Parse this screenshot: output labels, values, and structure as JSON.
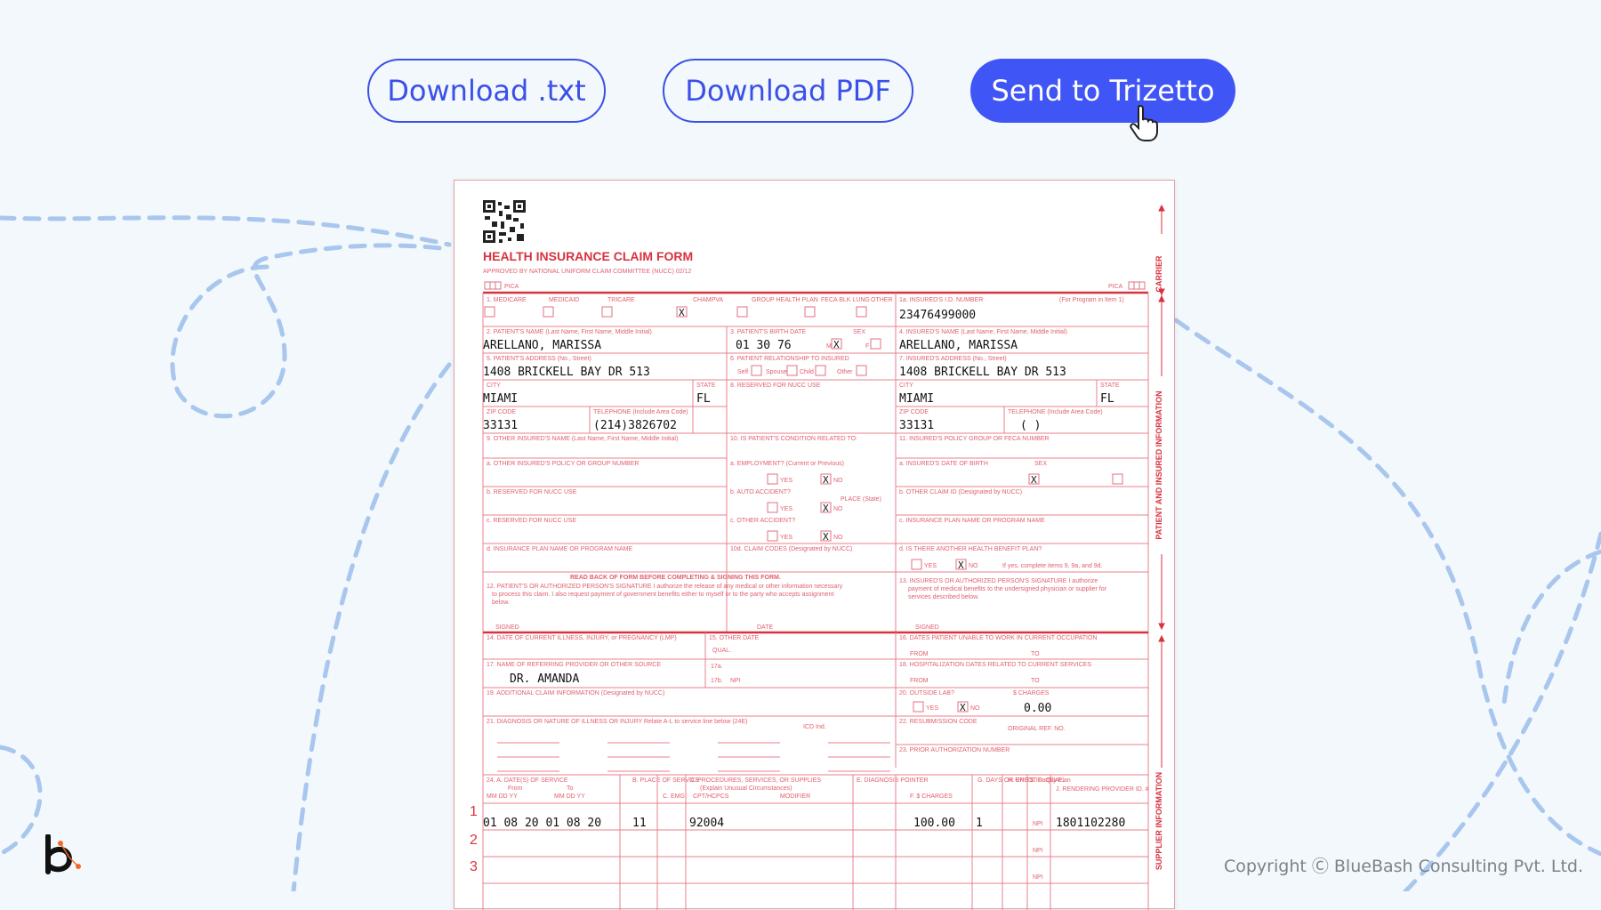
{
  "buttons": {
    "download_txt": "Download .txt",
    "download_pdf": "Download PDF",
    "send_trizetto": "Send to Trizetto"
  },
  "form": {
    "title": "HEALTH INSURANCE CLAIM FORM",
    "approved": "APPROVED BY NATIONAL UNIFORM CLAIM COMMITTEE (NUCC) 02/12",
    "pica": "PICA",
    "side_carrier": "CARRIER",
    "side_patient": "PATIENT AND INSURED INFORMATION",
    "side_supplier": "SUPPLIER INFORMATION",
    "insured_id": "23476499000",
    "patient_name": "ARELLANO, MARISSA",
    "birth_date": "01 30 76",
    "insured_name": "ARELLANO, MARISSA",
    "patient_address": "1408 BRICKELL BAY DR 513",
    "insured_address": "1408 BRICKELL BAY DR 513",
    "patient_city": "MIAMI",
    "patient_state": "FL",
    "insured_city": "MIAMI",
    "insured_state": "FL",
    "patient_zip": "33131",
    "patient_phone": "(214)3826702",
    "insured_zip": "33131",
    "insured_phone": "(   )",
    "referring_provider": "DR. AMANDA",
    "outside_lab_charges": "0.00",
    "service_line_num_1": "1",
    "service_line_num_2": "2",
    "service_line_num_3": "3",
    "service_line_1": {
      "dates": "01 08 20 01 08 20",
      "place": "11",
      "cpt": "92004",
      "charges": "100.00",
      "units": "1",
      "npi_label": "NPI",
      "provider_id": "1801102280"
    },
    "x_mark": "X",
    "labels": {
      "l1": "1. MEDICARE",
      "l1_medicaid": "MEDICAID",
      "l1_tricare": "TRICARE",
      "l1_champva": "CHAMPVA",
      "l1_group": "GROUP HEALTH PLAN",
      "l1_feca": "FECA BLK LUNG",
      "l1_other": "OTHER",
      "l1a": "1a. INSURED'S I.D. NUMBER",
      "l1a_note": "(For Program in Item 1)",
      "l2": "2. PATIENT'S NAME (Last Name, First Name, Middle Initial)",
      "l3": "3. PATIENT'S BIRTH DATE",
      "l3_sex": "SEX",
      "l4": "4. INSURED'S NAME (Last Name, First Name, Middle Initial)",
      "l5": "5. PATIENT'S ADDRESS (No., Street)",
      "l6": "6. PATIENT RELATIONSHIP TO INSURED",
      "l7": "7. INSURED'S ADDRESS (No., Street)",
      "city": "CITY",
      "state": "STATE",
      "l8": "8. RESERVED FOR NUCC USE",
      "zip": "ZIP CODE",
      "telephone": "TELEPHONE (Include Area Code)",
      "l9": "9. OTHER INSURED'S NAME (Last Name, First Name, Middle Initial)",
      "l10": "10. IS PATIENT'S CONDITION RELATED TO:",
      "l11": "11. INSURED'S POLICY GROUP OR FECA NUMBER",
      "l9a": "a. OTHER INSURED'S POLICY OR GROUP NUMBER",
      "l10a": "a. EMPLOYMENT? (Current or Previous)",
      "l11a": "a. INSURED'S DATE OF BIRTH",
      "l9b": "b. RESERVED FOR NUCC USE",
      "l10b": "b. AUTO ACCIDENT?",
      "l10b_place": "PLACE (State)",
      "l11b": "b. OTHER CLAIM ID (Designated by NUCC)",
      "l9c": "c. RESERVED FOR NUCC USE",
      "l10c": "c. OTHER ACCIDENT?",
      "l11c": "c. INSURANCE PLAN NAME OR PROGRAM NAME",
      "l9d": "d. INSURANCE PLAN NAME OR PROGRAM NAME",
      "l10d": "10d. CLAIM CODES (Designated by NUCC)",
      "l11d": "d. IS THERE ANOTHER HEALTH BENEFIT PLAN?",
      "l11d_note": "If yes, complete items 9, 9a, and 9d.",
      "read_back": "READ BACK OF FORM BEFORE COMPLETING & SIGNING THIS FORM.",
      "l12": "12. PATIENT'S OR AUTHORIZED PERSON'S SIGNATURE I authorize the release of any medical or other information necessary",
      "l12b": "to process this claim. I also request payment of government benefits either to myself or to the party who accepts assignment",
      "l12c": "below.",
      "l13": "13. INSURED'S OR AUTHORIZED PERSON'S SIGNATURE I authorize",
      "l13b": "payment of medical benefits to the undersigned physician or supplier for",
      "l13c": "services described below.",
      "signed": "SIGNED",
      "date": "DATE",
      "l14": "14. DATE OF CURRENT ILLNESS, INJURY, or PREGNANCY (LMP)",
      "l15": "15. OTHER DATE",
      "l16": "16. DATES PATIENT UNABLE TO WORK IN CURRENT OCCUPATION",
      "l17": "17. NAME OF REFERRING PROVIDER OR OTHER SOURCE",
      "l17a": "17a.",
      "l17b": "17b.",
      "npi": "NPI",
      "l18": "18. HOSPITALIZATION DATES RELATED TO CURRENT SERVICES",
      "l19": "19. ADDITIONAL CLAIM INFORMATION (Designated by NUCC)",
      "l20": "20. OUTSIDE LAB?",
      "l20_charges": "$ CHARGES",
      "l21": "21. DIAGNOSIS OR NATURE OF ILLNESS OR INJURY Relate A-L to service line below (24E)",
      "icd": "ICD Ind.",
      "l22": "22. RESUBMISSION CODE",
      "l22_ref": "ORIGINAL REF. NO.",
      "l23": "23. PRIOR AUTHORIZATION NUMBER",
      "l24a": "24. A. DATE(S) OF SERVICE",
      "from": "From",
      "to": "To",
      "mmddyy": "MM DD YY",
      "l24b": "B. PLACE OF SERVICE",
      "l24c": "C. EMG",
      "l24d": "D. PROCEDURES, SERVICES, OR SUPPLIES",
      "l24d2": "(Explain Unusual Circumstances)",
      "cpt": "CPT/HCPCS",
      "modifier": "MODIFIER",
      "l24e": "E. DIAGNOSIS POINTER",
      "l24f": "F. $ CHARGES",
      "l24g": "G. DAYS OR UNITS",
      "l24h": "H. EPSDT Family Plan",
      "l24i": "I. ID. QUAL.",
      "l24j": "J. RENDERING PROVIDER ID. #",
      "yes": "YES",
      "no": "NO",
      "self": "Self",
      "spouse": "Spouse",
      "child": "Child",
      "other": "Other",
      "mm": "MM",
      "dd": "DD",
      "yy": "YY",
      "m": "M",
      "f": "F",
      "qual": "QUAL.",
      "from_lbl": "FROM",
      "to_lbl": "TO"
    }
  },
  "footer": {
    "copyright": "Copyright Ⓒ BlueBash Consulting Pvt. Ltd."
  },
  "colors": {
    "accent": "#4055f5",
    "form_red": "#d8323f",
    "background": "#f2f8fb"
  },
  "icons": {
    "cursor": "hand-pointer-icon",
    "logo": "bluebash-logo-icon",
    "qr": "qr-code-icon"
  }
}
